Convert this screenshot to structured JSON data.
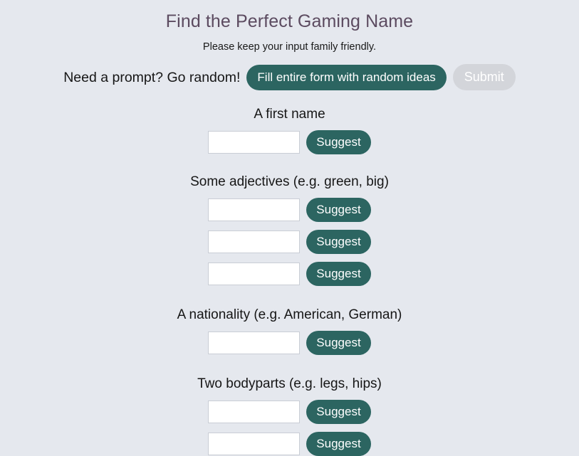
{
  "header": {
    "title": "Find the Perfect Gaming Name",
    "subtitle": "Please keep your input family friendly."
  },
  "random_row": {
    "label": "Need a prompt? Go random!",
    "fill_button": "Fill entire form with random ideas",
    "submit_button": "Submit",
    "submit_disabled": true
  },
  "suggest_label": "Suggest",
  "sections": [
    {
      "label": "A first name",
      "fields": [
        {
          "value": "",
          "placeholder": ""
        }
      ]
    },
    {
      "label": "Some adjectives (e.g. green, big)",
      "fields": [
        {
          "value": "",
          "placeholder": ""
        },
        {
          "value": "",
          "placeholder": ""
        },
        {
          "value": "",
          "placeholder": ""
        }
      ]
    },
    {
      "label": "A nationality (e.g. American, German)",
      "fields": [
        {
          "value": "",
          "placeholder": ""
        }
      ]
    },
    {
      "label": "Two bodyparts (e.g. legs, hips)",
      "fields": [
        {
          "value": "",
          "placeholder": ""
        },
        {
          "value": "",
          "placeholder": ""
        }
      ]
    }
  ],
  "colors": {
    "background": "#e5e8ee",
    "accent_teal": "#2c6561",
    "title_purple": "#5c4b60",
    "disabled_gray": "#d3d5da",
    "input_border": "#c9cdd5"
  }
}
